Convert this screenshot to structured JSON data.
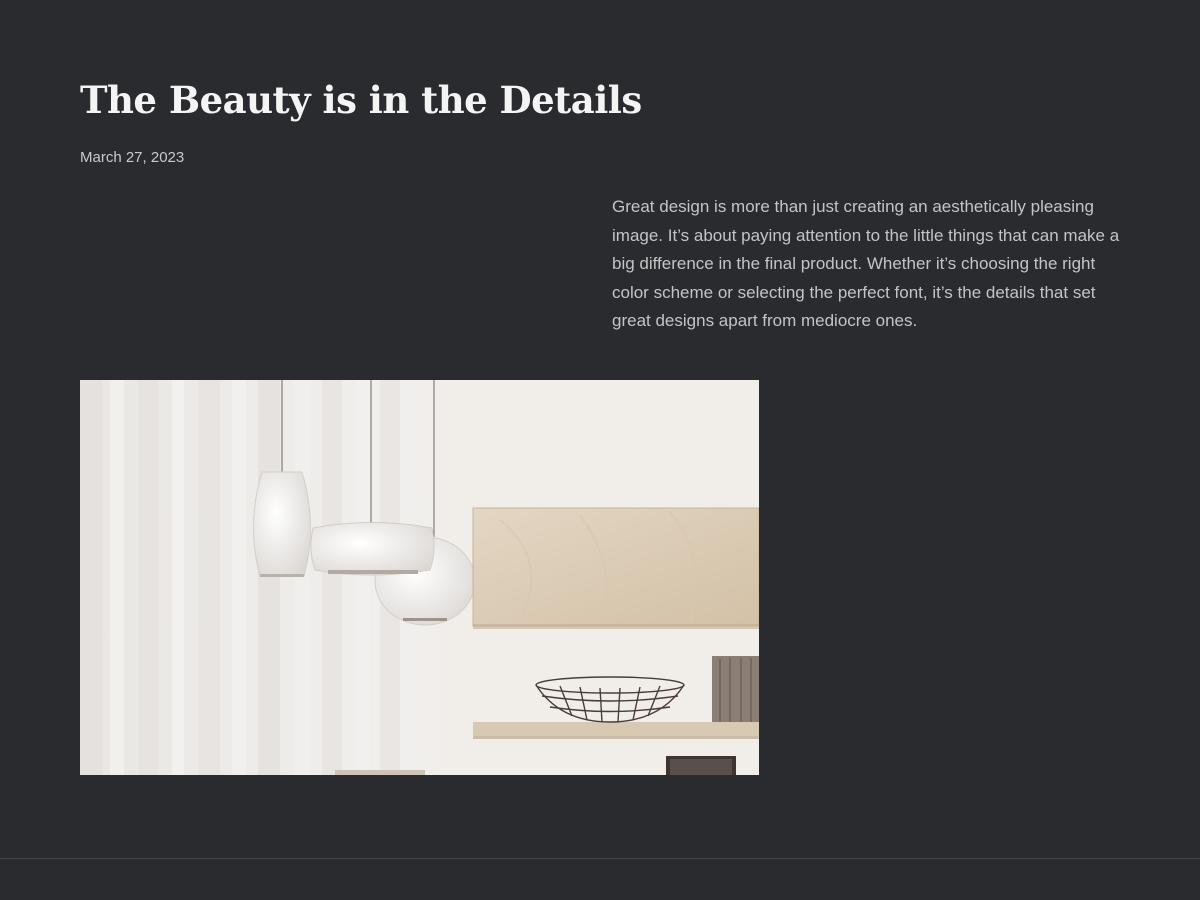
{
  "post": {
    "title": "The Beauty is in the Details",
    "date": "March 27, 2023",
    "excerpt": "Great design is more than just creating an aesthetically pleasing image. It’s about paying attention to the little things that can make a big difference in the final product. Whether it’s choosing the right color scheme or selecting the perfect font, it’s the details that set great designs apart from mediocre ones."
  },
  "hero_image": {
    "subject": "pendant-lamps-and-wooden-shelves"
  },
  "colors": {
    "background": "#2a2b2f",
    "title": "#f4f4f4",
    "body_text": "#c4c4c6",
    "divider": "#45464b"
  }
}
